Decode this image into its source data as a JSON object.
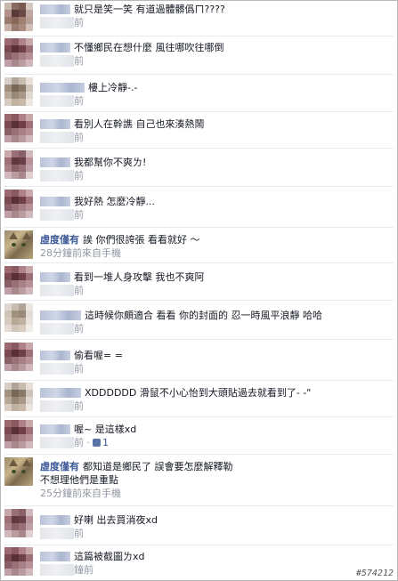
{
  "comments": [
    {
      "text": "就只是笑一笑 有道過體髒僞ㄇ????",
      "meta": "前",
      "blur_w": 34
    },
    {
      "text": "不懂鄉民在想什麼 風往哪吹往哪倒",
      "meta": "前",
      "blur_w": 34
    },
    {
      "text": "樓上冷靜-.-",
      "meta": "前",
      "blur_w": 50
    },
    {
      "text": "看別人在幹譙 自己也來湊熱鬧",
      "meta": "前",
      "blur_w": 34
    },
    {
      "text": "我都幫你不爽ㄌ!",
      "meta": "前",
      "blur_w": 34
    },
    {
      "text": "我好熱 怎麼冷靜...",
      "meta": "前",
      "blur_w": 34
    },
    {
      "name": "虛度僅有",
      "text": "誒 你們很誇張 看看就好 ～",
      "meta": "28分鐘前來自手機"
    },
    {
      "text": "看到一堆人身攻擊 我也不爽阿",
      "meta": "前",
      "blur_w": 34
    },
    {
      "text": "這時候你頗適合 看看 你的封面的 忍一時風平浪靜 哈哈",
      "meta": "前",
      "blur_w": 46
    },
    {
      "text": "偷看喔= =",
      "meta": "前",
      "blur_w": 34
    },
    {
      "text": "XDDDDDD 滑鼠不小心怡到大頭貼過去就看到了- -\"",
      "meta": "前",
      "blur_w": 46
    },
    {
      "text": "喔~ 是這樣xd",
      "meta": "前",
      "likes": "1",
      "blur_w": 34
    },
    {
      "name": "虛度僅有",
      "text": "都知道是鄉民了 誤會要怎麼解釋勒",
      "text2": "不想理他們是重點",
      "meta": "25分鐘前來自手機"
    },
    {
      "text": "好喇 出去買消夜xd",
      "meta": "前",
      "blur_w": 34
    },
    {
      "text": "這篇被截圖ㄌxd",
      "meta": "鐘前",
      "blur_w": 34
    }
  ],
  "footer": {
    "like_separator": "·",
    "watermark": "#574212"
  },
  "colors": {
    "link": "#3b5998",
    "meta": "#9197a3"
  },
  "icons": {
    "like": "thumbs-up-icon"
  }
}
